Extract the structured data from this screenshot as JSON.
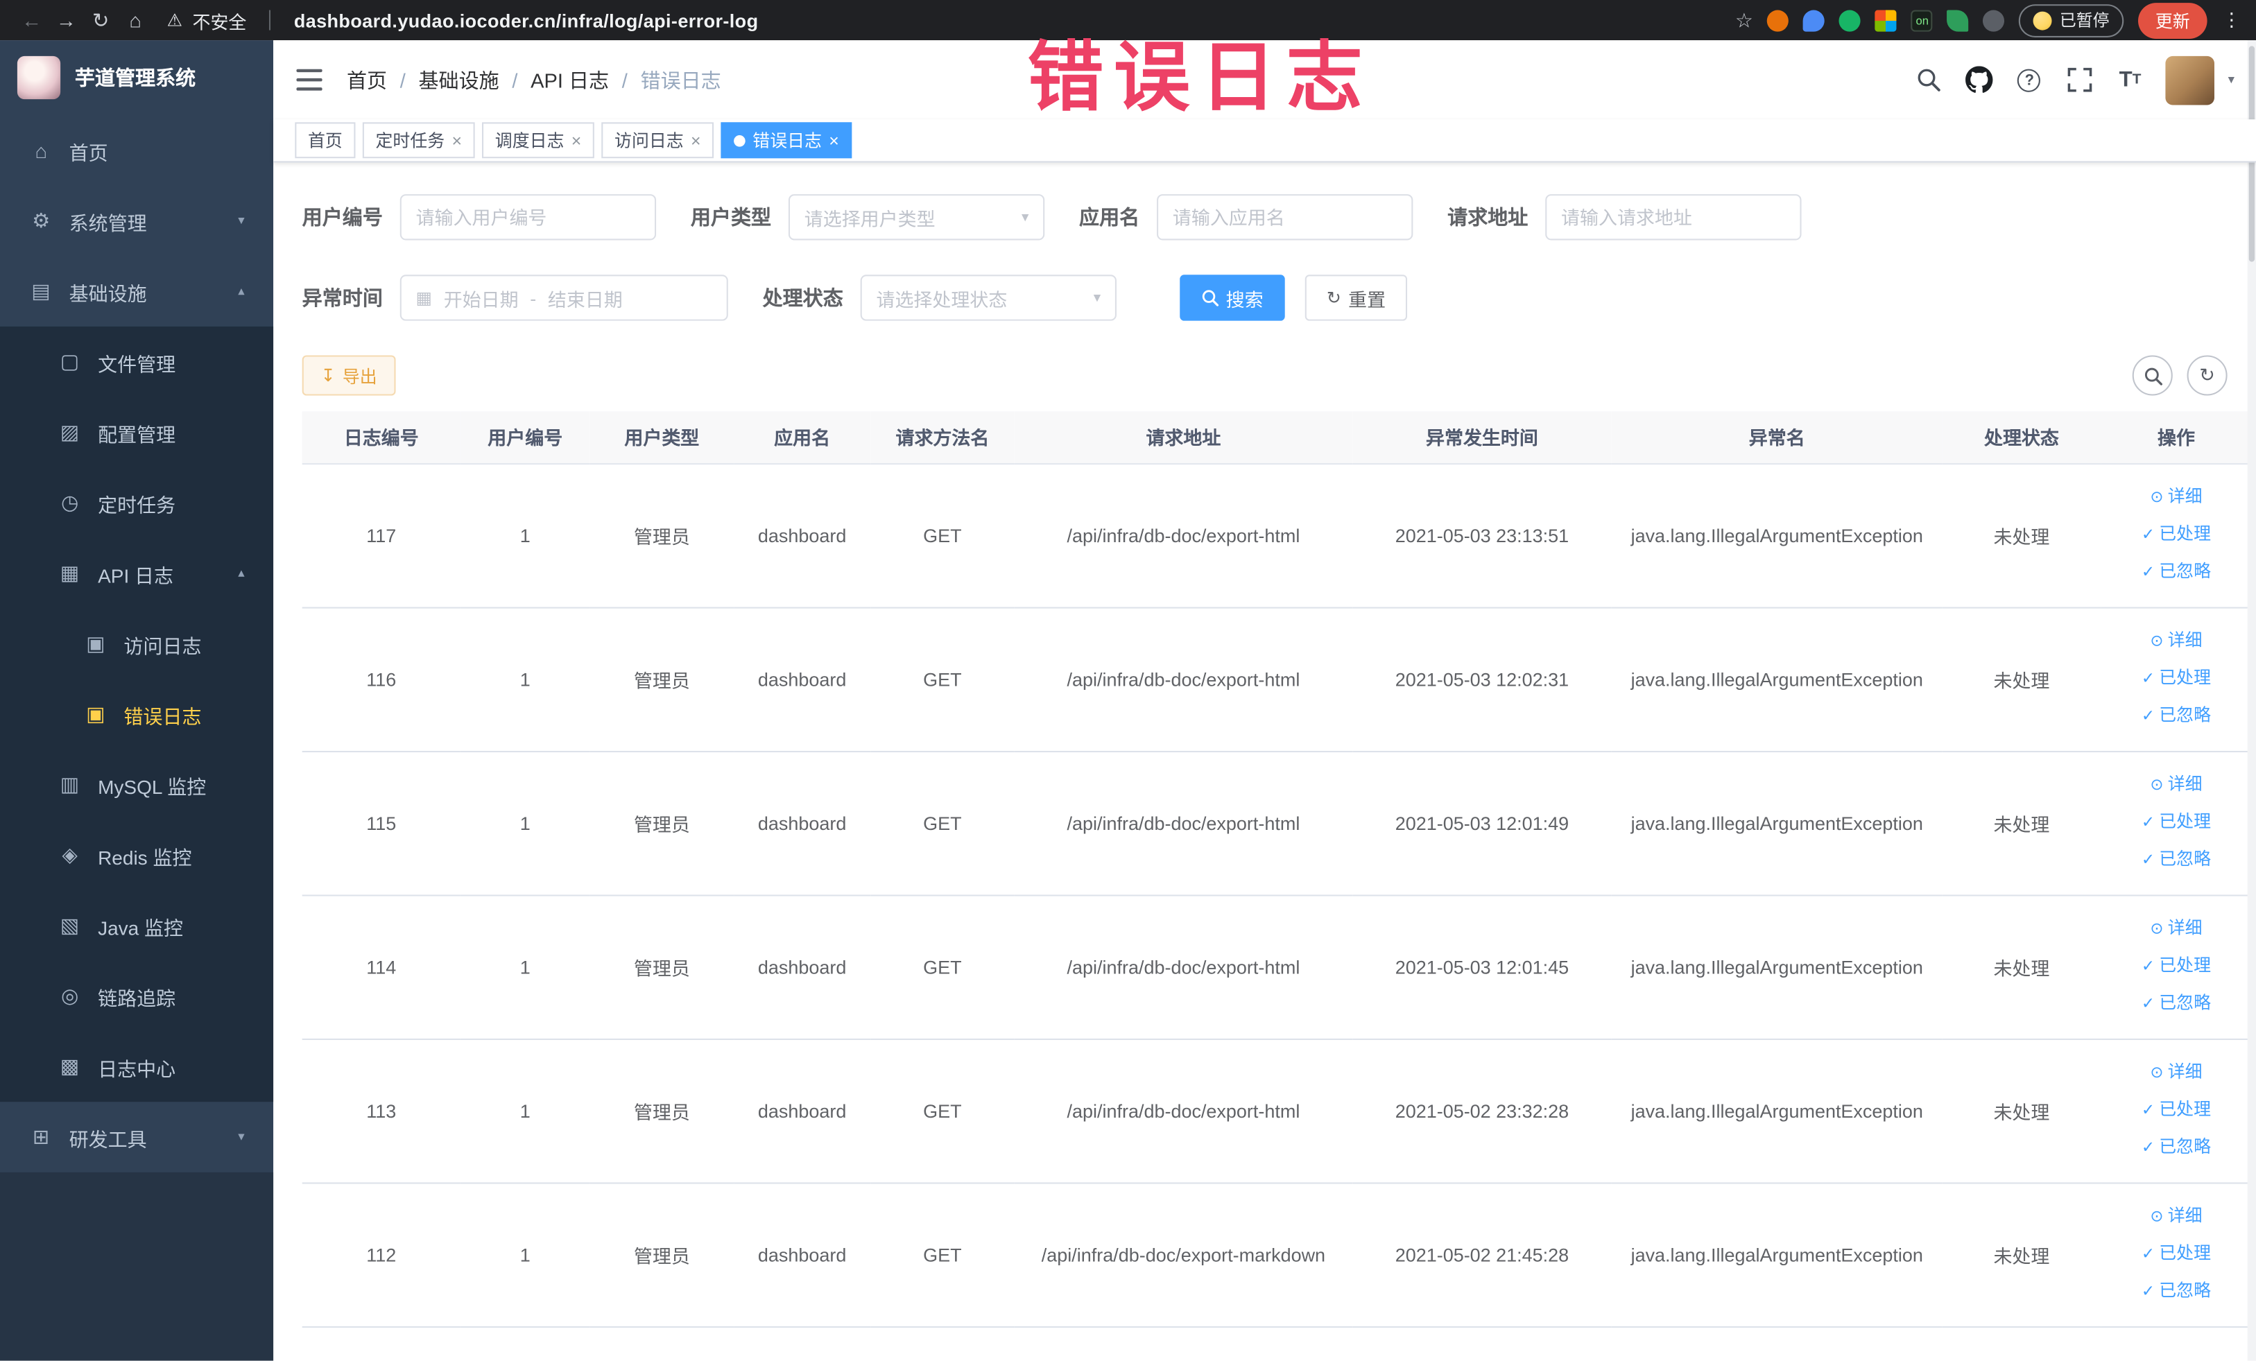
{
  "colors": {
    "accent": "#409eff",
    "sidebar_bg": "#304156",
    "sidebar_submenu_bg": "#1f2d3d",
    "sidebar_active_text": "#ffd04b",
    "warning_button": "#e6a23c",
    "watermark": "#ed4166",
    "chrome_bg": "#202124",
    "update_button": "#e25141"
  },
  "icons": {
    "back": "←",
    "forward": "→",
    "reload": "↻",
    "home": "⌂",
    "warning": "⚠",
    "star": "☆",
    "kebab": "⋮",
    "gear": "⚙",
    "infra": "▤",
    "file": "▢",
    "config": "▨",
    "cron": "◷",
    "api_log": "▦",
    "access_log": "▣",
    "error_log": "▣",
    "mysql": "▥",
    "redis": "◈",
    "java": "▧",
    "trace": "◎",
    "log_center": "▩",
    "devtools": "⊞",
    "chevron_down": "▾",
    "chevron_up": "▴",
    "caret_down": "▾",
    "close": "×",
    "active_dot": "●",
    "calendar": "▦",
    "select_arrow": "▾",
    "download": "↧",
    "refresh": "↻",
    "eye": "⊙",
    "check": "✓",
    "help": "?",
    "font_size_big": "T",
    "font_size_small": "T"
  },
  "browser": {
    "security_label": "不安全",
    "url": "dashboard.yudao.iocoder.cn/infra/log/api-error-log",
    "extensions_on_label": "on",
    "paused_label": "已暂停",
    "update_label": "更新"
  },
  "watermark_text": "错误日志",
  "sidebar": {
    "logo_title": "芋道管理系统",
    "items": [
      {
        "label": "首页"
      },
      {
        "label": "系统管理"
      },
      {
        "label": "基础设施"
      },
      {
        "label": "文件管理"
      },
      {
        "label": "配置管理"
      },
      {
        "label": "定时任务"
      },
      {
        "label": "API 日志"
      },
      {
        "label": "访问日志"
      },
      {
        "label": "错误日志"
      },
      {
        "label": "MySQL 监控"
      },
      {
        "label": "Redis 监控"
      },
      {
        "label": "Java 监控"
      },
      {
        "label": "链路追踪"
      },
      {
        "label": "日志中心"
      },
      {
        "label": "研发工具"
      }
    ]
  },
  "breadcrumb": {
    "separator": "/",
    "items": [
      "首页",
      "基础设施",
      "API 日志",
      "错误日志"
    ]
  },
  "tabs": [
    {
      "label": "首页"
    },
    {
      "label": "定时任务"
    },
    {
      "label": "调度日志"
    },
    {
      "label": "访问日志"
    },
    {
      "label": "错误日志"
    }
  ],
  "filters": {
    "user_id_label": "用户编号",
    "user_id_placeholder": "请输入用户编号",
    "user_type_label": "用户类型",
    "user_type_placeholder": "请选择用户类型",
    "app_name_label": "应用名",
    "app_name_placeholder": "请输入应用名",
    "request_url_label": "请求地址",
    "request_url_placeholder": "请输入请求地址",
    "exception_time_label": "异常时间",
    "date_start_placeholder": "开始日期",
    "date_separator": "-",
    "date_end_placeholder": "结束日期",
    "process_status_label": "处理状态",
    "process_status_placeholder": "请选择处理状态",
    "search_label": "搜索",
    "reset_label": "重置"
  },
  "toolbar": {
    "export_label": "导出"
  },
  "table": {
    "headers": [
      "日志编号",
      "用户编号",
      "用户类型",
      "应用名",
      "请求方法名",
      "请求地址",
      "异常发生时间",
      "异常名",
      "处理状态",
      "操作"
    ],
    "actions": [
      "详细",
      "已处理",
      "已忽略"
    ],
    "rows": [
      {
        "log_id": "117",
        "user_id": "1",
        "user_type": "管理员",
        "app": "dashboard",
        "method": "GET",
        "url": "/api/infra/db-doc/export-html",
        "time": "2021-05-03 23:13:51",
        "exception": "java.lang.IllegalArgumentException",
        "status": "未处理"
      },
      {
        "log_id": "116",
        "user_id": "1",
        "user_type": "管理员",
        "app": "dashboard",
        "method": "GET",
        "url": "/api/infra/db-doc/export-html",
        "time": "2021-05-03 12:02:31",
        "exception": "java.lang.IllegalArgumentException",
        "status": "未处理"
      },
      {
        "log_id": "115",
        "user_id": "1",
        "user_type": "管理员",
        "app": "dashboard",
        "method": "GET",
        "url": "/api/infra/db-doc/export-html",
        "time": "2021-05-03 12:01:49",
        "exception": "java.lang.IllegalArgumentException",
        "status": "未处理"
      },
      {
        "log_id": "114",
        "user_id": "1",
        "user_type": "管理员",
        "app": "dashboard",
        "method": "GET",
        "url": "/api/infra/db-doc/export-html",
        "time": "2021-05-03 12:01:45",
        "exception": "java.lang.IllegalArgumentException",
        "status": "未处理"
      },
      {
        "log_id": "113",
        "user_id": "1",
        "user_type": "管理员",
        "app": "dashboard",
        "method": "GET",
        "url": "/api/infra/db-doc/export-html",
        "time": "2021-05-02 23:32:28",
        "exception": "java.lang.IllegalArgumentException",
        "status": "未处理"
      },
      {
        "log_id": "112",
        "user_id": "1",
        "user_type": "管理员",
        "app": "dashboard",
        "method": "GET",
        "url": "/api/infra/db-doc/export-markdown",
        "time": "2021-05-02 21:45:28",
        "exception": "java.lang.IllegalArgumentException",
        "status": "未处理"
      }
    ]
  }
}
